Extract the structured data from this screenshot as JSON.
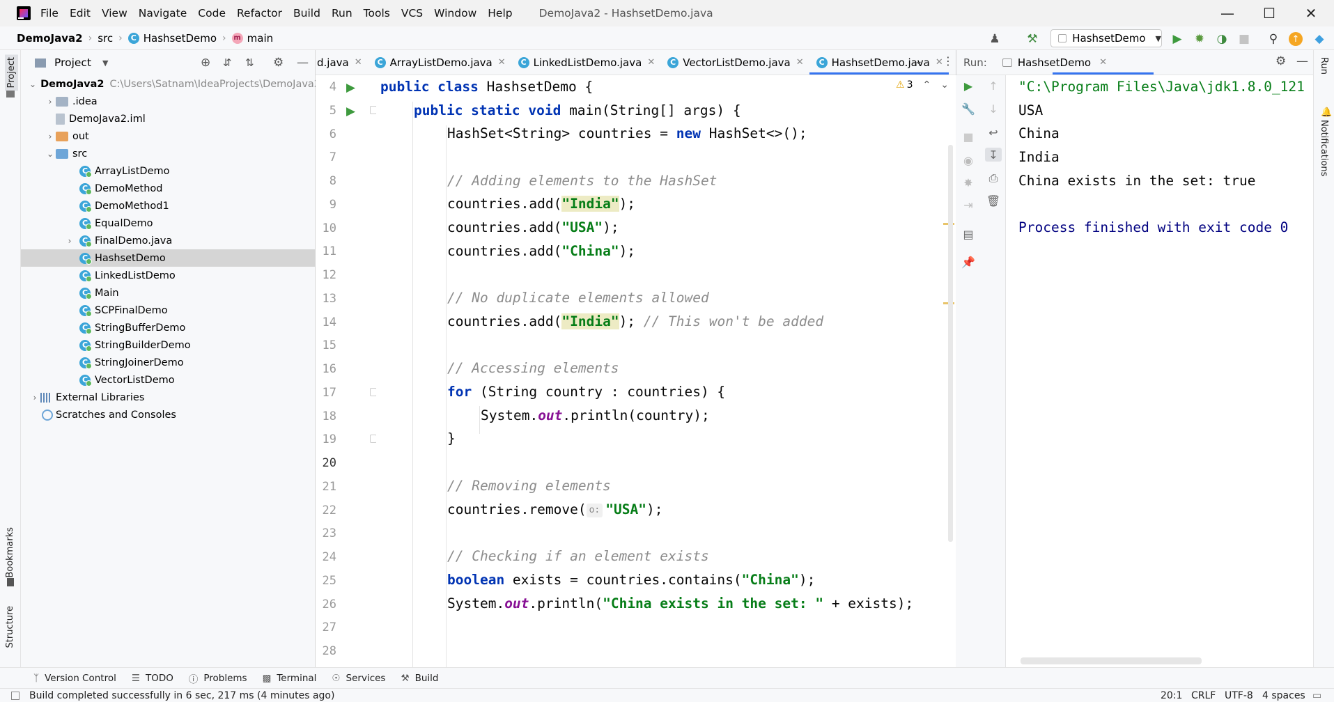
{
  "window": {
    "menu": [
      "File",
      "Edit",
      "View",
      "Navigate",
      "Code",
      "Refactor",
      "Build",
      "Run",
      "Tools",
      "VCS",
      "Window",
      "Help"
    ],
    "title": "DemoJava2 - HashsetDemo.java"
  },
  "breadcrumb": {
    "project": "DemoJava2",
    "src": "src",
    "class": "HashsetDemo",
    "method": "main"
  },
  "toolbar": {
    "run_config": "HashsetDemo"
  },
  "left_stripe": {
    "project": "Project",
    "bookmarks": "Bookmarks",
    "structure": "Structure"
  },
  "project_panel": {
    "title": "Project",
    "root": "DemoJava2",
    "root_path": "C:\\Users\\Satnam\\IdeaProjects\\DemoJava2",
    "items": [
      ".idea",
      "DemoJava2.iml",
      "out",
      "src",
      "ArrayListDemo",
      "DemoMethod",
      "DemoMethod1",
      "EqualDemo",
      "FinalDemo.java",
      "HashsetDemo",
      "LinkedListDemo",
      "Main",
      "SCPFinalDemo",
      "StringBufferDemo",
      "StringBuilderDemo",
      "StringJoinerDemo",
      "VectorListDemo",
      "External Libraries",
      "Scratches and Consoles"
    ]
  },
  "editor": {
    "tabs": [
      "d.java",
      "ArrayListDemo.java",
      "LinkedListDemo.java",
      "VectorListDemo.java",
      "HashsetDemo.java"
    ],
    "active_tab": "HashsetDemo.java",
    "warnings": "3",
    "line_numbers": [
      "4",
      "5",
      "6",
      "7",
      "8",
      "9",
      "10",
      "11",
      "12",
      "13",
      "14",
      "15",
      "16",
      "17",
      "18",
      "19",
      "20",
      "21",
      "22",
      "23",
      "24",
      "25",
      "26",
      "27",
      "28"
    ],
    "code": {
      "l4a": "public class",
      "l4b": " HashsetDemo {",
      "l5a": "public static void",
      "l5b": " main(String[] args) {",
      "l6a": "HashSet<String> countries = ",
      "l6b": "new",
      "l6c": " HashSet<>();",
      "l8": "// Adding elements to the HashSet",
      "l9a": "countries.add(",
      "l9b": "\"India\"",
      "l9c": ");",
      "l10a": "countries.add(",
      "l10b": "\"USA\"",
      "l10c": ");",
      "l11a": "countries.add(",
      "l11b": "\"China\"",
      "l11c": ");",
      "l13": "// No duplicate elements allowed",
      "l14a": "countries.add(",
      "l14b": "\"India\"",
      "l14c": "); ",
      "l14d": "// This won't be added",
      "l16": "// Accessing elements",
      "l17a": "for",
      "l17b": " (String country : countries) {",
      "l18a": "System.",
      "l18b": "out",
      "l18c": ".println(country);",
      "l19": "}",
      "l21": "// Removing elements",
      "l22a": "countries.remove(",
      "l22hint": "o:",
      "l22b": "\"USA\"",
      "l22c": ");",
      "l24": "// Checking if an element exists",
      "l25a": "boolean",
      "l25b": " exists = countries.contains(",
      "l25c": "\"China\"",
      "l25d": ");",
      "l26a": "System.",
      "l26b": "out",
      "l26c": ".println(",
      "l26d": "\"China exists in the set: \"",
      "l26e": " + exists);"
    }
  },
  "run_panel": {
    "label": "Run:",
    "tab": "HashsetDemo",
    "output": [
      "\"C:\\Program Files\\Java\\jdk1.8.0_121",
      "USA",
      "China",
      "India",
      "China exists in the set: true",
      "",
      "Process finished with exit code 0"
    ]
  },
  "right_stripe": {
    "run": "Run",
    "notifications": "Notifications"
  },
  "bottom_tools": [
    "Version Control",
    "TODO",
    "Problems",
    "Terminal",
    "Services",
    "Build"
  ],
  "status": {
    "message": "Build completed successfully in 6 sec, 217 ms (4 minutes ago)",
    "position": "20:1",
    "line_sep": "CRLF",
    "encoding": "UTF-8",
    "indent": "4 spaces"
  },
  "colors": {
    "accent": "#3574f0",
    "keyword": "#0033b3",
    "string": "#067d17",
    "comment": "#8c8c8c",
    "field": "#871094",
    "console_end": "#000080"
  }
}
